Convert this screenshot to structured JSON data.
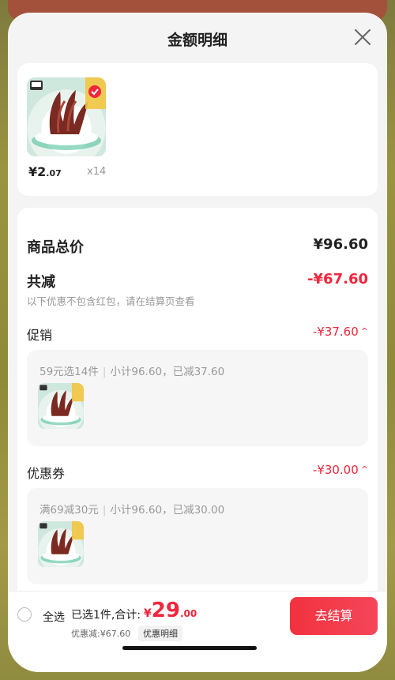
{
  "sheet": {
    "title": "金额明细"
  },
  "product": {
    "price_int": "¥2",
    "price_dec": ".07",
    "qty": "x14"
  },
  "summary": {
    "total_label": "商品总价",
    "total_value": "¥96.60",
    "reduce_label": "共减",
    "reduce_value": "-¥67.60",
    "note": "以下优惠不包含红包，请在结算页查看"
  },
  "promo": {
    "label": "促销",
    "value": "-¥37.60",
    "rule": "59元选14件",
    "detail": "小计96.60，已减37.60"
  },
  "coupon": {
    "label": "优惠券",
    "value": "-¥30.00",
    "rule": "满69减30元",
    "detail": "小计96.60，已减30.00"
  },
  "bottom": {
    "select_all": "全选",
    "selected": "已选1件,合计:",
    "currency": "¥",
    "total_int": "29",
    "total_dec": ".00",
    "discount": "优惠减:¥67.60",
    "detail_tag": "优惠明细",
    "checkout": "去结算"
  },
  "colors": {
    "accent": "#f0263c",
    "sheet_bg": "#f4f4f4"
  },
  "icons": [
    "close-icon",
    "chevron-up-icon",
    "product-thumbnail",
    "radio-icon"
  ]
}
